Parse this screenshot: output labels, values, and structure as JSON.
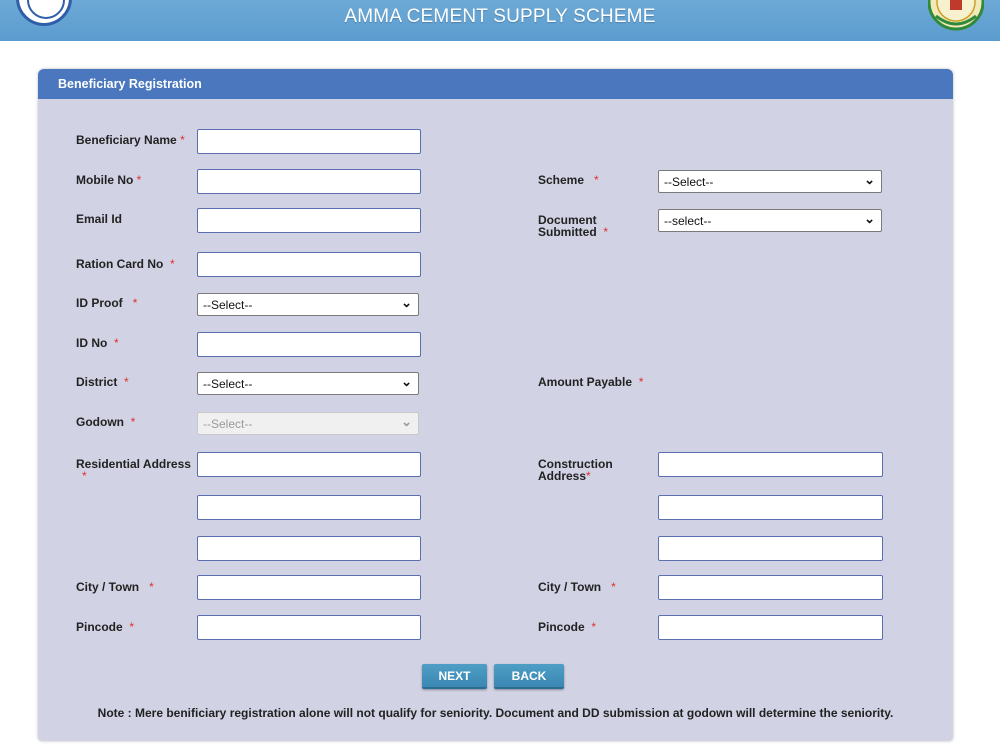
{
  "header": {
    "title": "AMMA CEMENT SUPPLY SCHEME"
  },
  "panel": {
    "title": "Beneficiary Registration"
  },
  "form": {
    "beneficiary_name": {
      "label": "Beneficiary Name",
      "required": "*",
      "value": ""
    },
    "mobile_no": {
      "label": "Mobile No",
      "required": "*",
      "value": ""
    },
    "email_id": {
      "label": "Email Id",
      "value": ""
    },
    "ration_card_no": {
      "label": "Ration Card No",
      "required": "*",
      "value": ""
    },
    "id_proof": {
      "label": "ID Proof",
      "required": "*",
      "selected": "--Select--"
    },
    "id_no": {
      "label": "ID No",
      "required": "*",
      "value": ""
    },
    "district": {
      "label": "District",
      "required": "*",
      "selected": "--Select--"
    },
    "godown": {
      "label": "Godown",
      "required": "*",
      "selected": "--Select--"
    },
    "residential_address": {
      "label": "Residential Address",
      "required": "*"
    },
    "city_town_left": {
      "label": "City / Town",
      "required": "*"
    },
    "pincode_left": {
      "label": "Pincode",
      "required": "*"
    },
    "scheme": {
      "label": "Scheme",
      "required": "*",
      "selected": "--Select--"
    },
    "document_submitted": {
      "label_line1": "Document",
      "label_line2": "Submitted",
      "required": "*",
      "selected": "--select--"
    },
    "amount_payable": {
      "label": "Amount Payable",
      "required": "*"
    },
    "construction_address": {
      "label_line1": "Construction",
      "label_line2": "Address",
      "required": "*"
    },
    "city_town_right": {
      "label": "City / Town",
      "required": "*"
    },
    "pincode_right": {
      "label": "Pincode",
      "required": "*"
    }
  },
  "buttons": {
    "next": "NEXT",
    "back": "BACK"
  },
  "note": "Note : Mere benificiary registration alone will not qualify for seniority. Document and DD submission at godown will determine the seniority.",
  "colors": {
    "header": "#5b9ccf",
    "panel": "#d1d2e4",
    "panel_head": "#4a77bd",
    "required": "#e03030",
    "button": "#3a88b3"
  },
  "icons": {
    "left_logo": "emblem-logo",
    "right_logo": "government-seal-logo",
    "select_arrow": "chevron-down-icon"
  }
}
